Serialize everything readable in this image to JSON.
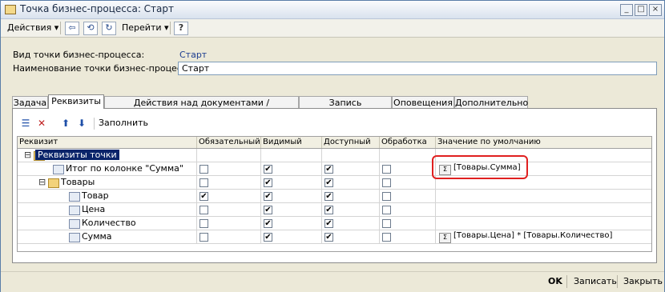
{
  "window": {
    "title": "Точка бизнес-процесса: Старт"
  },
  "toolbar": {
    "actions": "Действия",
    "goto": "Перейти",
    "help": "?"
  },
  "form": {
    "type_label": "Вид точки бизнес-процесса:",
    "type_value": "Старт",
    "name_label": "Наименование точки бизнес-процесса:",
    "name_value": "Старт"
  },
  "tabs": [
    {
      "label": "Задача"
    },
    {
      "label": "Реквизиты"
    },
    {
      "label": "Действия над документами / справочниками"
    },
    {
      "label": "Запись показателей"
    },
    {
      "label": "Оповещения"
    },
    {
      "label": "Дополнительно"
    }
  ],
  "panel": {
    "fill": "Заполнить"
  },
  "table": {
    "columns": [
      "Реквизит",
      "Обязательный",
      "Видимый",
      "Доступный",
      "Обработка",
      "Значение по умолчанию"
    ],
    "rows": [
      {
        "name": "Реквизиты точки",
        "required": false,
        "visible": false,
        "access": false,
        "process": false,
        "default": ""
      },
      {
        "name": "Итог по колонке \"Сумма\"",
        "required": false,
        "visible": true,
        "access": true,
        "process": false,
        "default": "[Товары.Сумма]"
      },
      {
        "name": "Товары",
        "required": false,
        "visible": true,
        "access": true,
        "process": false,
        "default": ""
      },
      {
        "name": "Товар",
        "required": true,
        "visible": true,
        "access": true,
        "process": false,
        "default": ""
      },
      {
        "name": "Цена",
        "required": false,
        "visible": true,
        "access": true,
        "process": false,
        "default": ""
      },
      {
        "name": "Количество",
        "required": false,
        "visible": true,
        "access": true,
        "process": false,
        "default": ""
      },
      {
        "name": "Сумма",
        "required": false,
        "visible": true,
        "access": true,
        "process": false,
        "default": "[Товары.Цена] * [Товары.Количество]"
      }
    ]
  },
  "bottom": {
    "ok": "OK",
    "save": "Записать",
    "close": "Закрыть"
  }
}
